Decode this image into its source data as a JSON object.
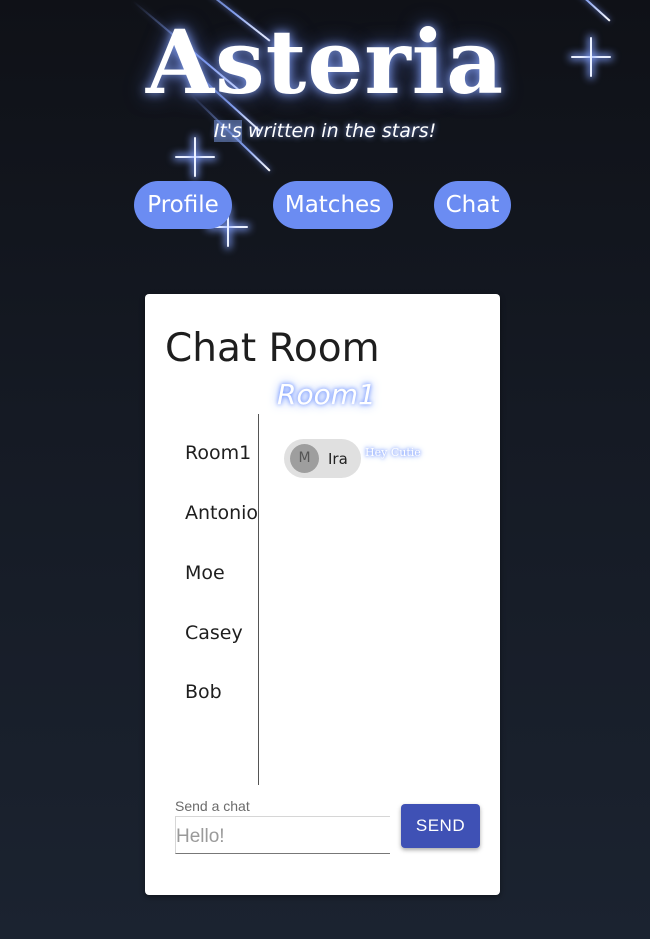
{
  "header": {
    "brand": "Asteria",
    "tagline_highlight": "It's",
    "tagline_rest": " written in the stars!"
  },
  "nav": [
    {
      "label": "Profile"
    },
    {
      "label": "Matches"
    },
    {
      "label": "Chat"
    }
  ],
  "chat_room": {
    "title": "Chat Room",
    "active_room": "Room1",
    "rooms": [
      {
        "label": "Room1"
      },
      {
        "label": "Antonio"
      },
      {
        "label": "Moe"
      },
      {
        "label": "Casey"
      },
      {
        "label": "Bob"
      }
    ],
    "messages": [
      {
        "avatar_initial": "M",
        "sender": "Ira",
        "text": "Hey Cutie"
      }
    ],
    "input": {
      "label": "Send a chat",
      "placeholder": "Hello!"
    },
    "send_label": "SEND"
  },
  "colors": {
    "accent": "#6b8cf2",
    "send_button": "#3f51b5",
    "chip": "#e0e0e0",
    "glow": "#7b9cff"
  },
  "icons": {
    "sparkle": "sparkle-icon"
  }
}
